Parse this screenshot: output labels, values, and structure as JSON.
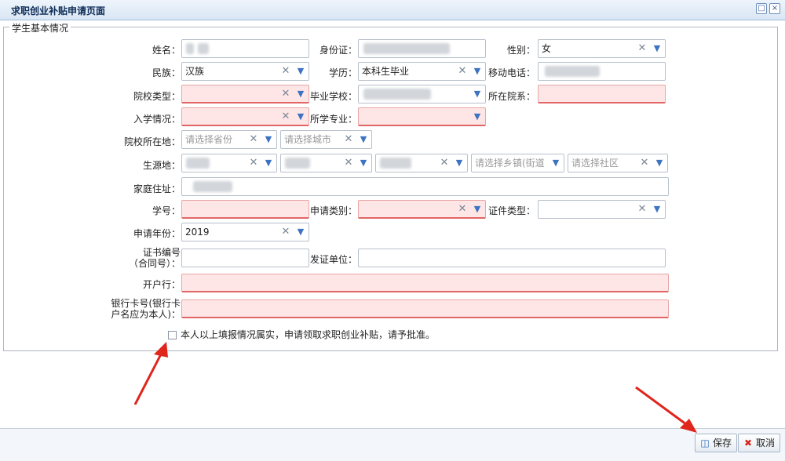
{
  "window": {
    "title": "求职创业补贴申请页面",
    "restore_icon": "restore-icon",
    "close_icon": "close-icon"
  },
  "fieldset": {
    "legend": "学生基本情况"
  },
  "fields": {
    "name": {
      "label": "姓名："
    },
    "id_card": {
      "label": "身份证："
    },
    "gender": {
      "label": "性别：",
      "value": "女"
    },
    "ethnicity": {
      "label": "民族：",
      "value": "汉族"
    },
    "education": {
      "label": "学历：",
      "value": "本科生毕业"
    },
    "mobile": {
      "label": "移动电话："
    },
    "school_type": {
      "label": "院校类型："
    },
    "graduate_school": {
      "label": "毕业学校："
    },
    "department": {
      "label": "所在院系："
    },
    "enrollment": {
      "label": "入学情况："
    },
    "major": {
      "label": "所学专业："
    },
    "school_location": {
      "label": "院校所在地：",
      "province_placeholder": "请选择省份",
      "city_placeholder": "请选择城市"
    },
    "origin": {
      "label": "生源地：",
      "town_placeholder": "请选择乡镇(街道",
      "community_placeholder": "请选择社区"
    },
    "home_address": {
      "label": "家庭住址："
    },
    "student_no": {
      "label": "学号："
    },
    "apply_category": {
      "label": "申请类别："
    },
    "cert_type": {
      "label": "证件类型："
    },
    "apply_year": {
      "label": "申请年份：",
      "value": "2019"
    },
    "cert_no": {
      "label": "证书编号（合同号）："
    },
    "issuer": {
      "label": "发证单位："
    },
    "bank": {
      "label": "开户行："
    },
    "bank_card": {
      "label": "银行卡号(银行卡户名应为本人)："
    }
  },
  "declaration": {
    "text": "本人以上填报情况属实，申请领取求职创业补贴，请予批准。",
    "checked": false
  },
  "footer": {
    "save_label": "保存",
    "cancel_label": "取消"
  },
  "colors": {
    "required_bg": "#ffe6e6",
    "title_bar": "#d9e6f4",
    "annotation_arrow": "#e0251c"
  }
}
